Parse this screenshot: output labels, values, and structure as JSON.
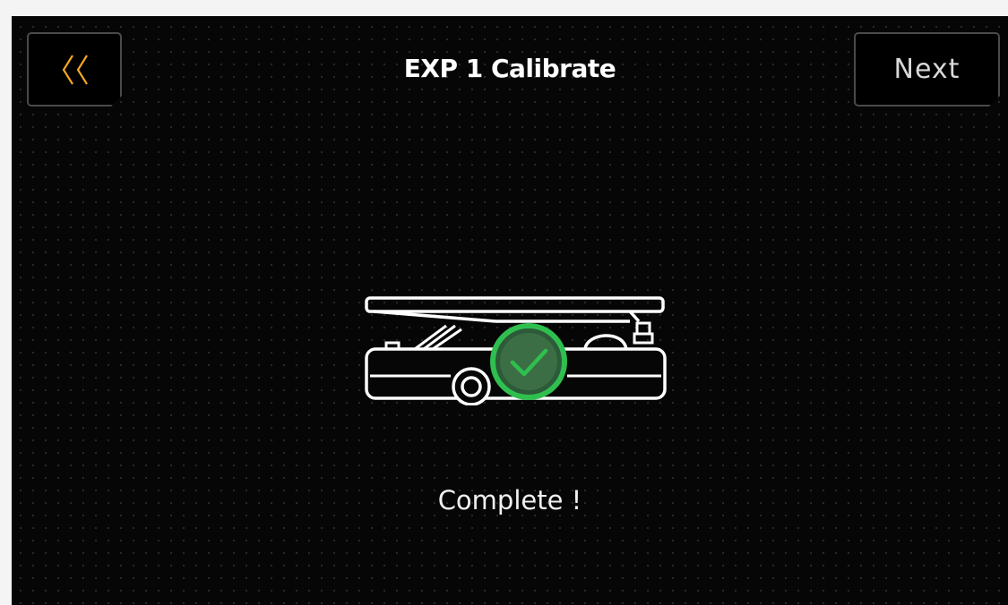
{
  "header": {
    "title": "EXP 1 Calibrate",
    "next_label": "Next"
  },
  "status": {
    "message": "Complete !"
  },
  "icons": {
    "back": "double-chevron-left-icon",
    "pedal": "expression-pedal-icon",
    "check": "check-circle-icon"
  },
  "colors": {
    "background": "#060606",
    "accent": "#f5a623",
    "success": "#2fbf4f",
    "border": "#4a4a4a"
  }
}
